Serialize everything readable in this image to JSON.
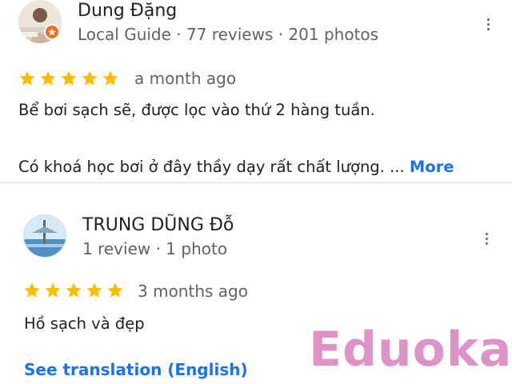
{
  "reviews": [
    {
      "author": "Dung Đặng",
      "meta": "Local Guide · 77 reviews · 201 photos",
      "rating": 5,
      "time": "a month ago",
      "text_line1": "Bể bơi sạch sẽ, được lọc vào thứ 2 hàng tuần.",
      "text_line2": "Có khoá học bơi ở đây thầy dạy rất chất lượng. ...",
      "more_label": "More"
    },
    {
      "author": "TRUNG DŨNG Đỗ",
      "meta": "1 review · 1 photo",
      "rating": 5,
      "time": "3 months ago",
      "text": "Hồ sạch và đẹp",
      "translate_label": "See translation (English)"
    }
  ],
  "watermark": "Eduoka",
  "colors": {
    "star": "#fbbc04",
    "link": "#1a73e8",
    "badge": "#f26d21",
    "watermark": "#dc8ec4"
  },
  "icons": [
    "avatar",
    "local-guide-badge-icon",
    "more-options-icon",
    "star-icon"
  ]
}
